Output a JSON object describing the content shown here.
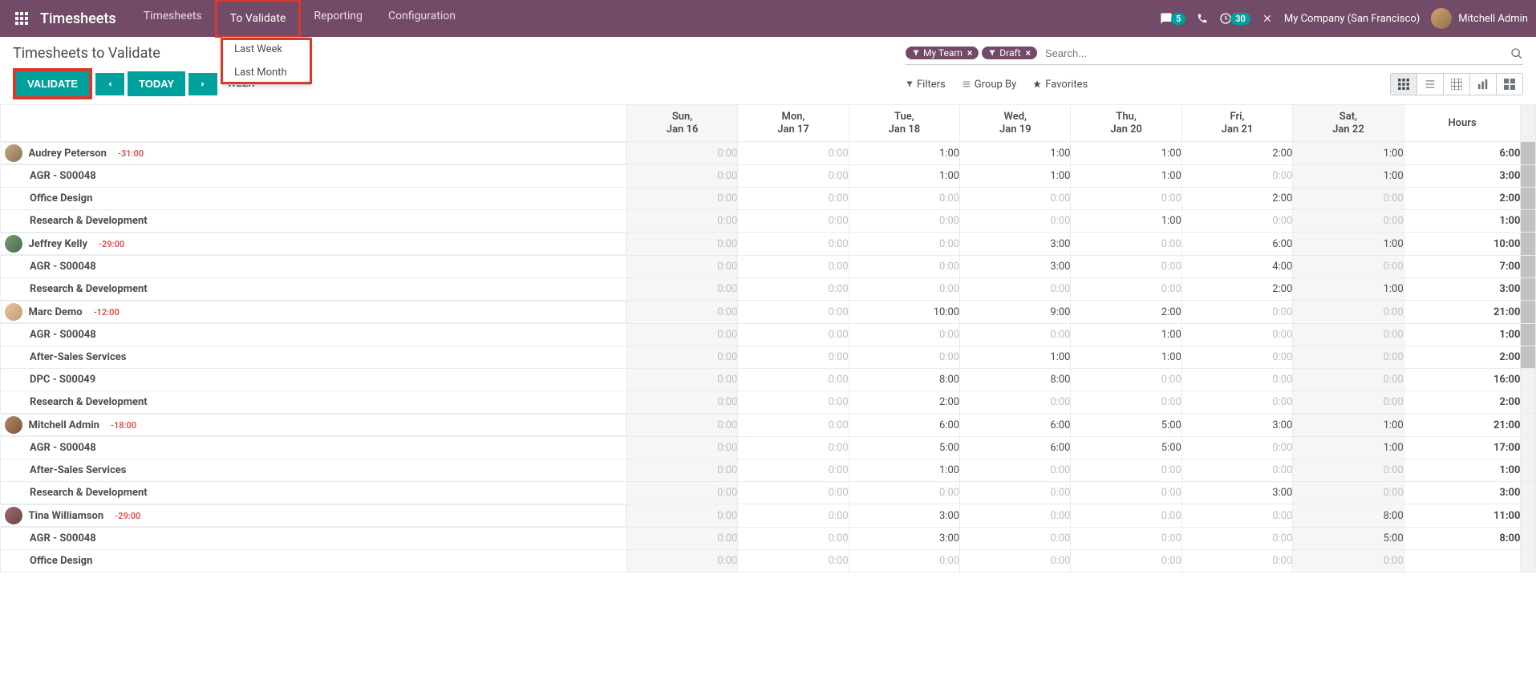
{
  "navbar": {
    "brand": "Timesheets",
    "items": [
      "Timesheets",
      "To Validate",
      "Reporting",
      "Configuration"
    ],
    "activeIndex": 1,
    "messagesBadge": "5",
    "activitiesBadge": "30",
    "company": "My Company (San Francisco)",
    "user": "Mitchell Admin"
  },
  "dropdown": {
    "items": [
      "Last Week",
      "Last Month"
    ]
  },
  "page": {
    "title": "Timesheets to Validate",
    "validateLabel": "VALIDATE",
    "todayLabel": "TODAY",
    "modeLabel": "WEEK"
  },
  "search": {
    "facets": [
      {
        "label": "My Team"
      },
      {
        "label": "Draft"
      }
    ],
    "placeholder": "Search..."
  },
  "toolbar": {
    "filters": "Filters",
    "groupBy": "Group By",
    "favorites": "Favorites"
  },
  "columns": {
    "days": [
      {
        "dow": "Sun,",
        "date": "Jan 16",
        "weekend": true
      },
      {
        "dow": "Mon,",
        "date": "Jan 17",
        "weekend": false
      },
      {
        "dow": "Tue,",
        "date": "Jan 18",
        "weekend": false
      },
      {
        "dow": "Wed,",
        "date": "Jan 19",
        "weekend": false
      },
      {
        "dow": "Thu,",
        "date": "Jan 20",
        "weekend": false
      },
      {
        "dow": "Fri,",
        "date": "Jan 21",
        "weekend": false
      },
      {
        "dow": "Sat,",
        "date": "Jan 22",
        "weekend": true
      }
    ],
    "hoursHeader": "Hours"
  },
  "rows": [
    {
      "type": "person",
      "avatar": "av1",
      "name": "Audrey Peterson",
      "badge": "-31:00",
      "cells": [
        "0:00",
        "0:00",
        "1:00",
        "1:00",
        "1:00",
        "2:00",
        "1:00"
      ],
      "total": "6:00"
    },
    {
      "type": "task",
      "name": "AGR - S00048",
      "cells": [
        "0:00",
        "0:00",
        "1:00",
        "1:00",
        "1:00",
        "0:00",
        "1:00"
      ],
      "total": "3:00"
    },
    {
      "type": "task",
      "name": "Office Design",
      "cells": [
        "0:00",
        "0:00",
        "0:00",
        "0:00",
        "0:00",
        "2:00",
        "0:00"
      ],
      "total": "2:00"
    },
    {
      "type": "task",
      "name": "Research & Development",
      "cells": [
        "0:00",
        "0:00",
        "0:00",
        "0:00",
        "1:00",
        "0:00",
        "0:00"
      ],
      "total": "1:00"
    },
    {
      "type": "person",
      "avatar": "av2",
      "name": "Jeffrey Kelly",
      "badge": "-29:00",
      "cells": [
        "0:00",
        "0:00",
        "0:00",
        "3:00",
        "0:00",
        "6:00",
        "1:00"
      ],
      "total": "10:00"
    },
    {
      "type": "task",
      "name": "AGR - S00048",
      "cells": [
        "0:00",
        "0:00",
        "0:00",
        "3:00",
        "0:00",
        "4:00",
        "0:00"
      ],
      "total": "7:00"
    },
    {
      "type": "task",
      "name": "Research & Development",
      "cells": [
        "0:00",
        "0:00",
        "0:00",
        "0:00",
        "0:00",
        "2:00",
        "1:00"
      ],
      "total": "3:00"
    },
    {
      "type": "person",
      "avatar": "av3",
      "name": "Marc Demo",
      "badge": "-12:00",
      "cells": [
        "0:00",
        "0:00",
        "10:00",
        "9:00",
        "2:00",
        "0:00",
        "0:00"
      ],
      "total": "21:00"
    },
    {
      "type": "task",
      "name": "AGR - S00048",
      "cells": [
        "0:00",
        "0:00",
        "0:00",
        "0:00",
        "1:00",
        "0:00",
        "0:00"
      ],
      "total": "1:00"
    },
    {
      "type": "task",
      "name": "After-Sales Services",
      "cells": [
        "0:00",
        "0:00",
        "0:00",
        "1:00",
        "1:00",
        "0:00",
        "0:00"
      ],
      "total": "2:00"
    },
    {
      "type": "task",
      "name": "DPC - S00049",
      "cells": [
        "0:00",
        "0:00",
        "8:00",
        "8:00",
        "0:00",
        "0:00",
        "0:00"
      ],
      "total": "16:00"
    },
    {
      "type": "task",
      "name": "Research & Development",
      "cells": [
        "0:00",
        "0:00",
        "2:00",
        "0:00",
        "0:00",
        "0:00",
        "0:00"
      ],
      "total": "2:00"
    },
    {
      "type": "person",
      "avatar": "av4",
      "name": "Mitchell Admin",
      "badge": "-18:00",
      "cells": [
        "0:00",
        "0:00",
        "6:00",
        "6:00",
        "5:00",
        "3:00",
        "1:00"
      ],
      "total": "21:00"
    },
    {
      "type": "task",
      "name": "AGR - S00048",
      "cells": [
        "0:00",
        "0:00",
        "5:00",
        "6:00",
        "5:00",
        "0:00",
        "1:00"
      ],
      "total": "17:00"
    },
    {
      "type": "task",
      "name": "After-Sales Services",
      "cells": [
        "0:00",
        "0:00",
        "1:00",
        "0:00",
        "0:00",
        "0:00",
        "0:00"
      ],
      "total": "1:00"
    },
    {
      "type": "task",
      "name": "Research & Development",
      "cells": [
        "0:00",
        "0:00",
        "0:00",
        "0:00",
        "0:00",
        "3:00",
        "0:00"
      ],
      "total": "3:00"
    },
    {
      "type": "person",
      "avatar": "av5",
      "name": "Tina Williamson",
      "badge": "-29:00",
      "cells": [
        "0:00",
        "0:00",
        "3:00",
        "0:00",
        "0:00",
        "0:00",
        "8:00"
      ],
      "total": "11:00"
    },
    {
      "type": "task",
      "name": "AGR - S00048",
      "cells": [
        "0:00",
        "0:00",
        "3:00",
        "0:00",
        "0:00",
        "0:00",
        "5:00"
      ],
      "total": "8:00"
    },
    {
      "type": "task",
      "name": "Office Design",
      "cells": [
        "0:00",
        "0:00",
        "0:00",
        "0:00",
        "0:00",
        "0:00",
        "0:00"
      ],
      "total": ""
    }
  ]
}
